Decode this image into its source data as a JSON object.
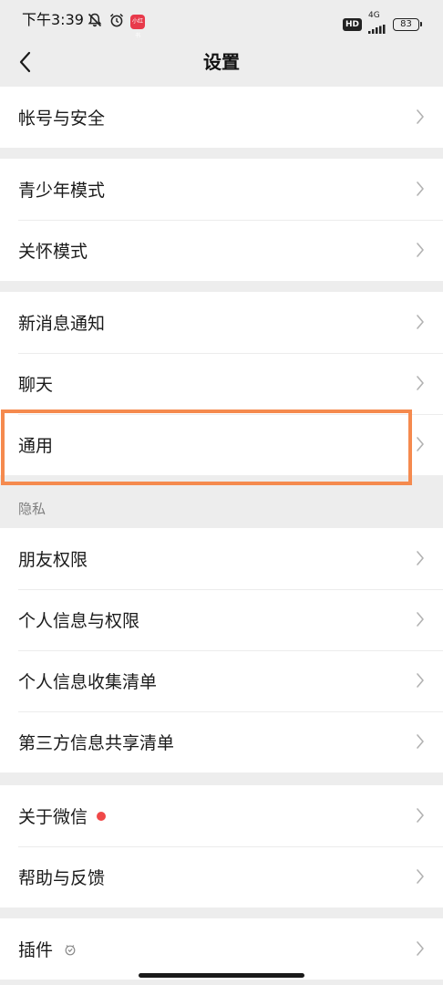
{
  "status_bar": {
    "time": "下午3:39",
    "app_badge_text": "小红书",
    "hd_label": "HD",
    "network_label": "4G",
    "battery": "83"
  },
  "nav": {
    "title": "设置",
    "back_icon": "chevron-left-icon"
  },
  "groups": {
    "account": {
      "items": [
        {
          "label": "帐号与安全"
        }
      ]
    },
    "modes": {
      "items": [
        {
          "label": "青少年模式"
        },
        {
          "label": "关怀模式"
        }
      ]
    },
    "general": {
      "items": [
        {
          "label": "新消息通知"
        },
        {
          "label": "聊天"
        },
        {
          "label": "通用"
        }
      ]
    },
    "privacy": {
      "header": "隐私",
      "items": [
        {
          "label": "朋友权限"
        },
        {
          "label": "个人信息与权限"
        },
        {
          "label": "个人信息收集清单"
        },
        {
          "label": "第三方信息共享清单"
        }
      ]
    },
    "about": {
      "items": [
        {
          "label": "关于微信"
        },
        {
          "label": "帮助与反馈"
        }
      ]
    },
    "plugins": {
      "items": [
        {
          "label": "插件"
        }
      ]
    }
  },
  "colors": {
    "background": "#ededed",
    "card": "#ffffff",
    "highlight": "#f58a4e",
    "notification_dot": "#f04848"
  }
}
